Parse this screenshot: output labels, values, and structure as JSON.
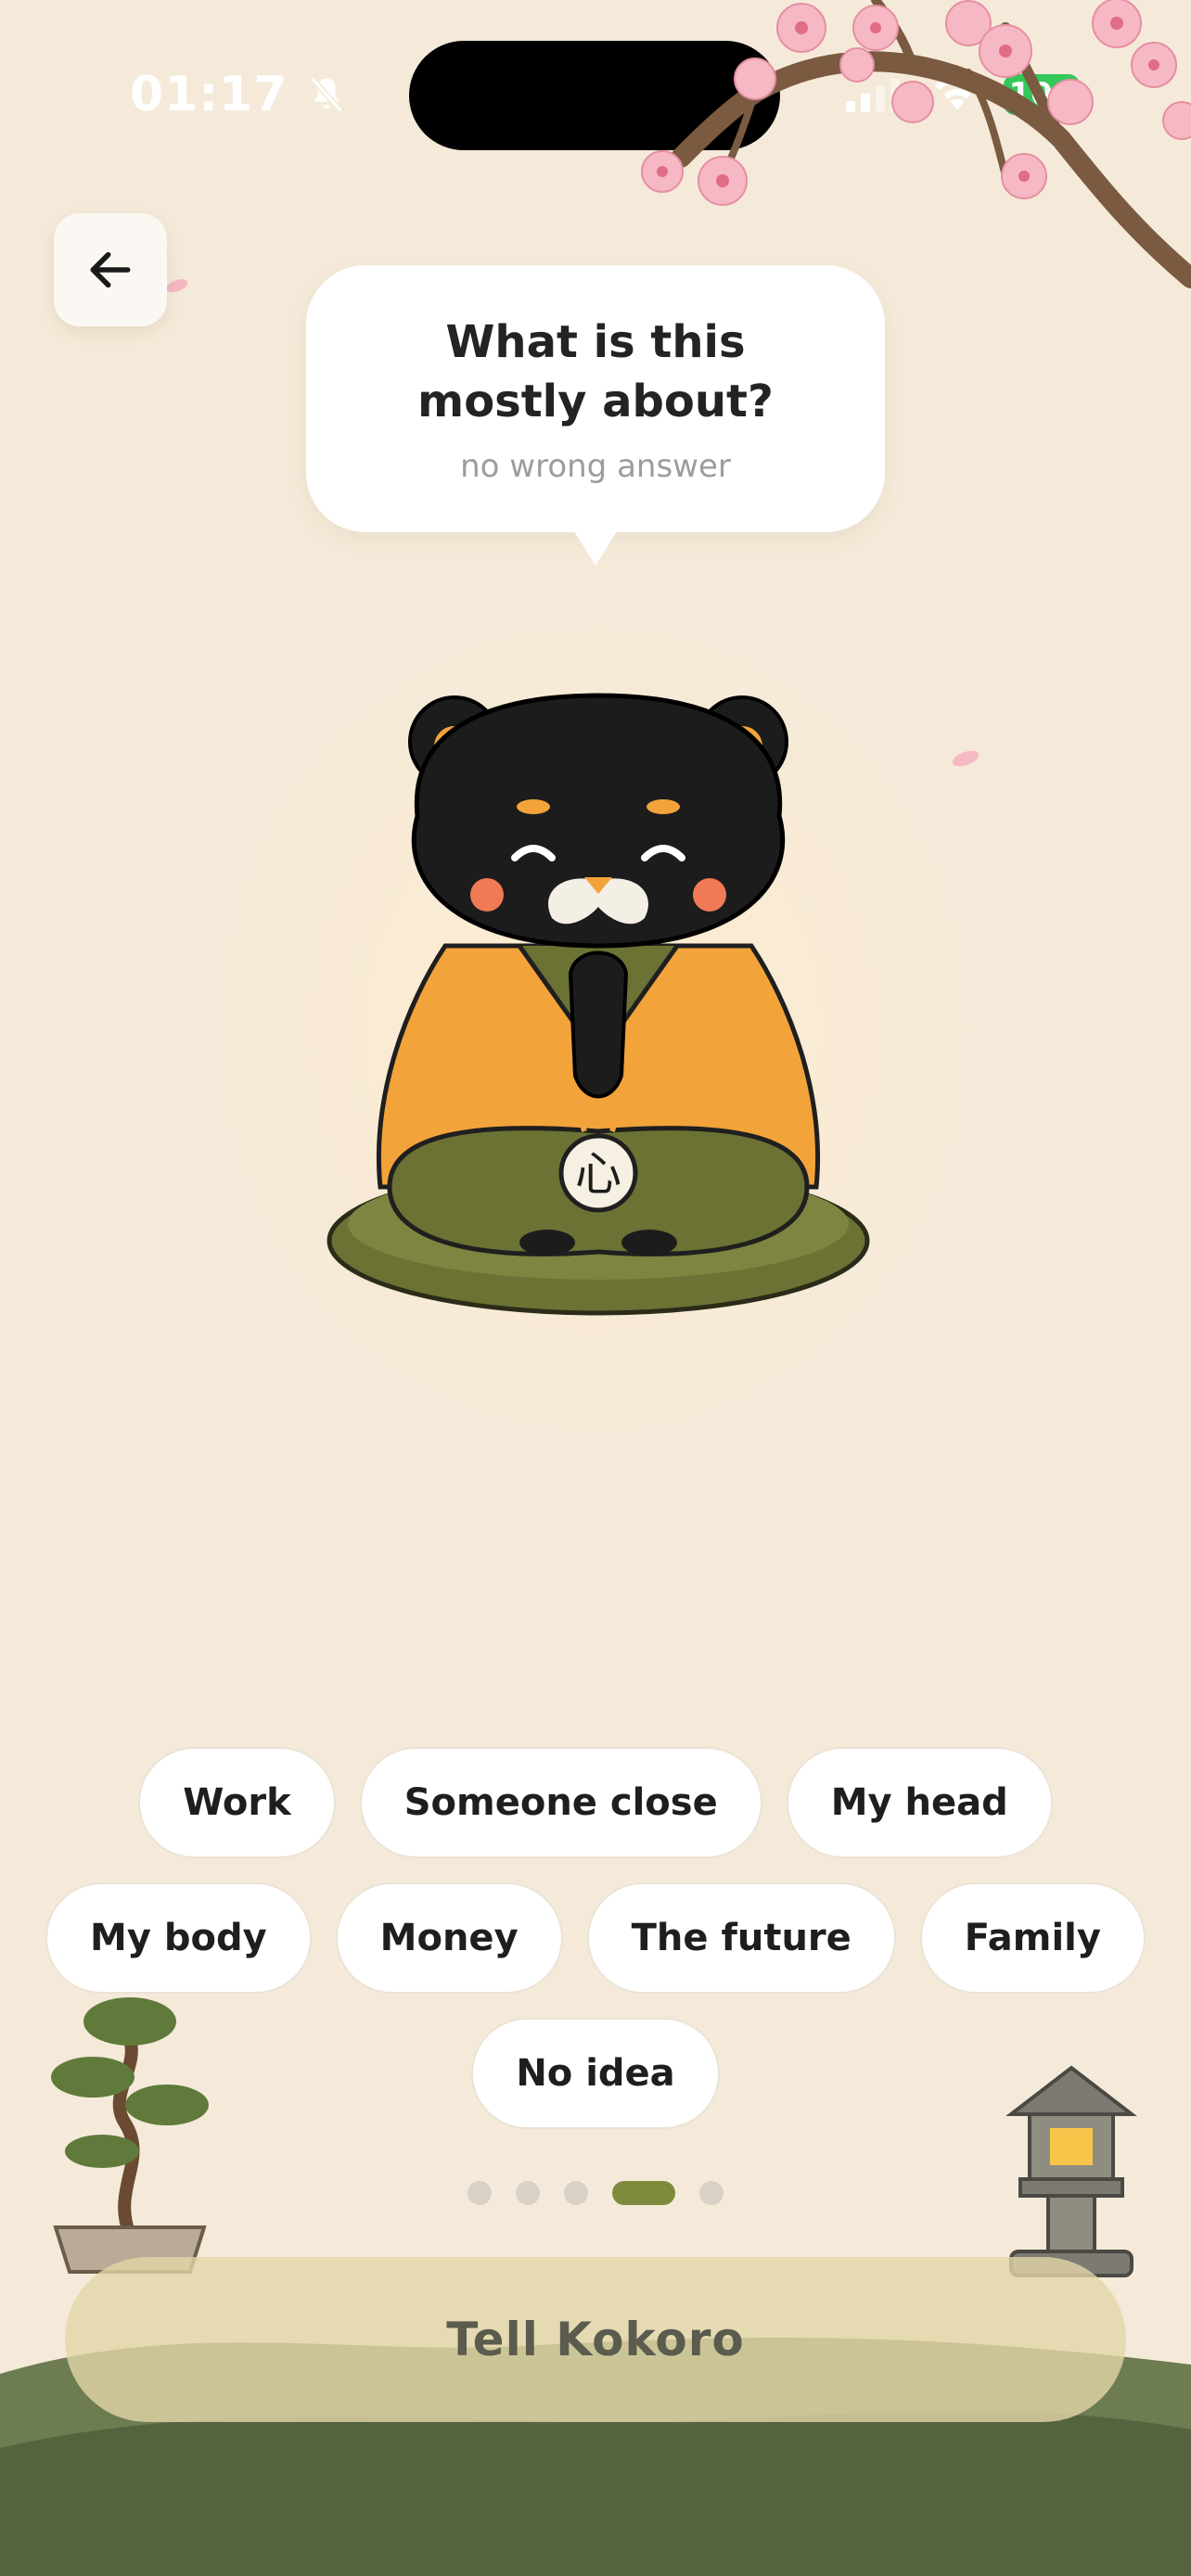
{
  "status_bar": {
    "time": "01:17",
    "battery": "100",
    "battery_color": "#34c759"
  },
  "header": {
    "back_icon": "arrow-left-icon"
  },
  "prompt": {
    "title": "What is this\nmostly about?",
    "subtitle": "no wrong answer"
  },
  "mascot": {
    "kanji": "心"
  },
  "options": {
    "rows": [
      [
        "Work",
        "Someone close",
        "My head"
      ],
      [
        "My body",
        "Money",
        "The future",
        "Family"
      ],
      [
        "No idea"
      ]
    ]
  },
  "pager": {
    "total": 5,
    "current": 4,
    "active_color": "#7e8a3c"
  },
  "cta": {
    "label": "Tell Kokoro"
  },
  "colors": {
    "background": "#f5ead9",
    "robe": "#f2a43a",
    "cushion": "#6b7233",
    "hills": "#5f6e48"
  }
}
